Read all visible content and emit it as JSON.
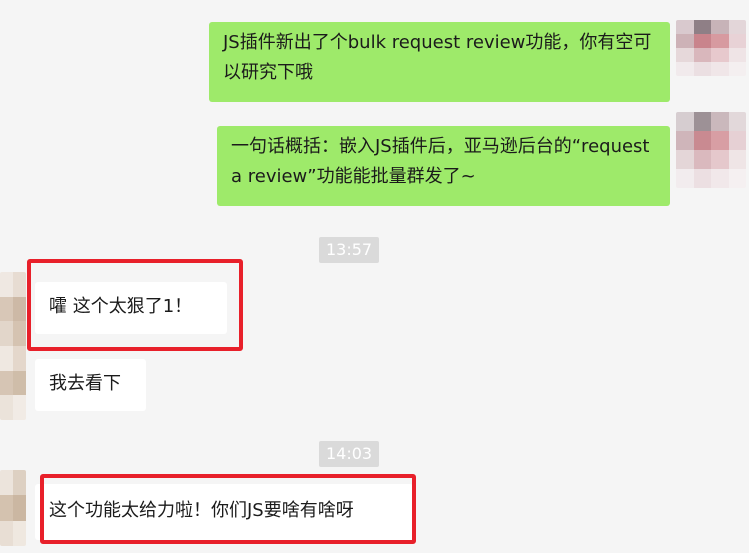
{
  "messages": [
    {
      "side": "out",
      "text": "JS插件新出了个bulk request review功能，你有空可以研究下哦"
    },
    {
      "side": "out",
      "text": "一句话概括：嵌入JS插件后，亚马逊后台的“request a review”功能能批量群发了~"
    },
    {
      "side": "in",
      "text": "嚯 这个太狠了1！"
    },
    {
      "side": "in",
      "text": "我去看下"
    },
    {
      "side": "in",
      "text": "这个功能太给力啦！你们JS要啥有啥呀"
    }
  ],
  "timestamps": [
    "13:57",
    "14:03"
  ],
  "colors": {
    "background": "#f5f5f5",
    "outgoing_bubble": "#9eea6a",
    "incoming_bubble": "#ffffff",
    "timestamp_bg": "#dadada",
    "highlight_box": "#e8202a"
  }
}
